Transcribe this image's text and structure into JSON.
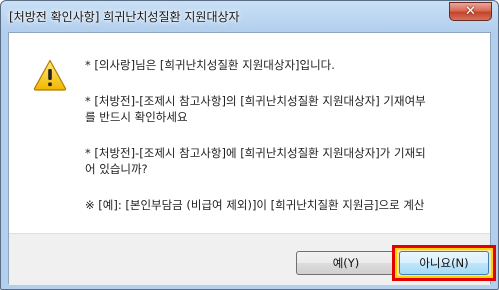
{
  "window": {
    "title": "[처방전 확인사항] 희귀난치성질환 지원대상자",
    "close_glyph": "✕"
  },
  "icon": "warning-icon",
  "message": {
    "line1": "* [의사랑]님은 [희귀난치성질환 지원대상자]입니다.",
    "line2a": "* [처방전]-[조제시 참고사항]의 [희귀난치성질환 지원대상자] 기재여부",
    "line2b": "를 반드시 확인하세요",
    "line3a": "* [처방전]-[조제시 참고사항]에 [희귀난치성질환 지원대상자]가 기재되",
    "line3b": "어 있습니까?",
    "line4": "※ [예]: [본인부담금 (비급여 제외)]이 [희귀난치질환 지원금]으로 계산"
  },
  "buttons": {
    "yes": "예(Y)",
    "no": "아니요(N)"
  },
  "colors": {
    "highlight_border": "#e20000",
    "highlight_inner": "#ffd400",
    "title_gradient": "#b3cfee"
  }
}
